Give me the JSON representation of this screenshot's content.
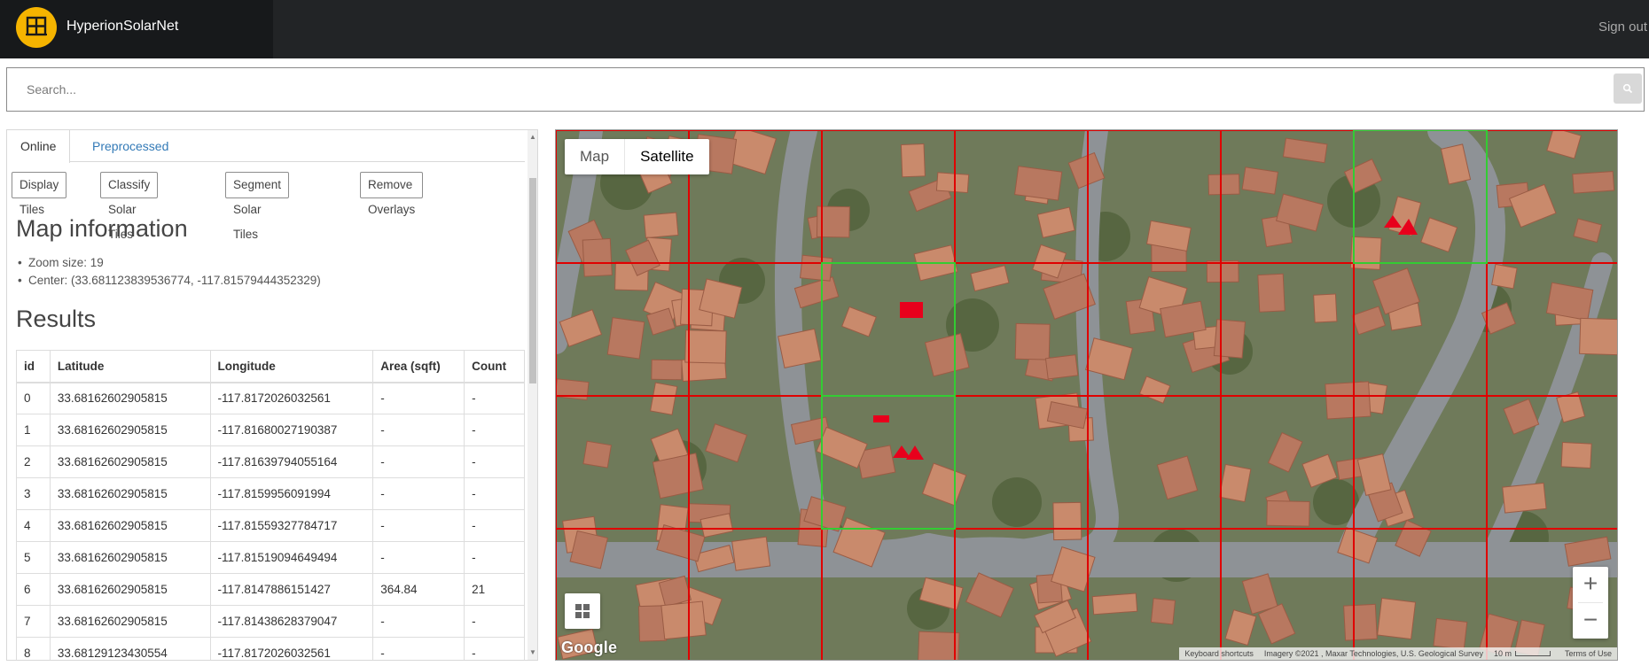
{
  "header": {
    "brand": "HyperionSolarNet",
    "signout_label": "Sign out",
    "logo_icon": "solar-panel-logo-icon",
    "brand_color": "#f5b400"
  },
  "search": {
    "placeholder": "Search...",
    "button_icon": "search-icon"
  },
  "panel": {
    "tabs": [
      {
        "label": "Online",
        "active": true
      },
      {
        "label": "Preprocessed",
        "active": false
      }
    ],
    "actions": [
      "Display Tiles",
      "Classify Solar Tiles",
      "Segment Solar Tiles",
      "Remove Overlays"
    ],
    "map_info": {
      "title": "Map information",
      "zoom": "Zoom size: 19",
      "center": "Center: (33.681123839536774, -117.81579444352329)"
    },
    "results": {
      "title": "Results",
      "columns": [
        "id",
        "Latitude",
        "Longitude",
        "Area (sqft)",
        "Count"
      ],
      "rows": [
        [
          "0",
          "33.68162602905815",
          "-117.8172026032561",
          "-",
          "-"
        ],
        [
          "1",
          "33.68162602905815",
          "-117.81680027190387",
          "-",
          "-"
        ],
        [
          "2",
          "33.68162602905815",
          "-117.81639794055164",
          "-",
          "-"
        ],
        [
          "3",
          "33.68162602905815",
          "-117.8159956091994",
          "-",
          "-"
        ],
        [
          "4",
          "33.68162602905815",
          "-117.81559327784717",
          "-",
          "-"
        ],
        [
          "5",
          "33.68162602905815",
          "-117.81519094649494",
          "-",
          "-"
        ],
        [
          "6",
          "33.68162602905815",
          "-117.8147886151427",
          "364.84",
          "21"
        ],
        [
          "7",
          "33.68162602905815",
          "-117.81438628379047",
          "-",
          "-"
        ],
        [
          "8",
          "33.68129123430554",
          "-117.8172026032561",
          "-",
          "-"
        ]
      ]
    }
  },
  "map": {
    "type_map_label": "Map",
    "type_satellite_label": "Satellite",
    "active_type": "Satellite",
    "zoom_in_label": "+",
    "zoom_out_label": "−",
    "google_label": "Google",
    "attribution": {
      "shortcuts": "Keyboard shortcuts",
      "imagery": "Imagery ©2021 , Maxar Technologies, U.S. Geological Survey",
      "scale": "10 m",
      "terms": "Terms of Use"
    },
    "grid_color_default": "#e00000",
    "grid_color_solar": "#33cc33",
    "solar_mask_color": "#e8001c"
  }
}
